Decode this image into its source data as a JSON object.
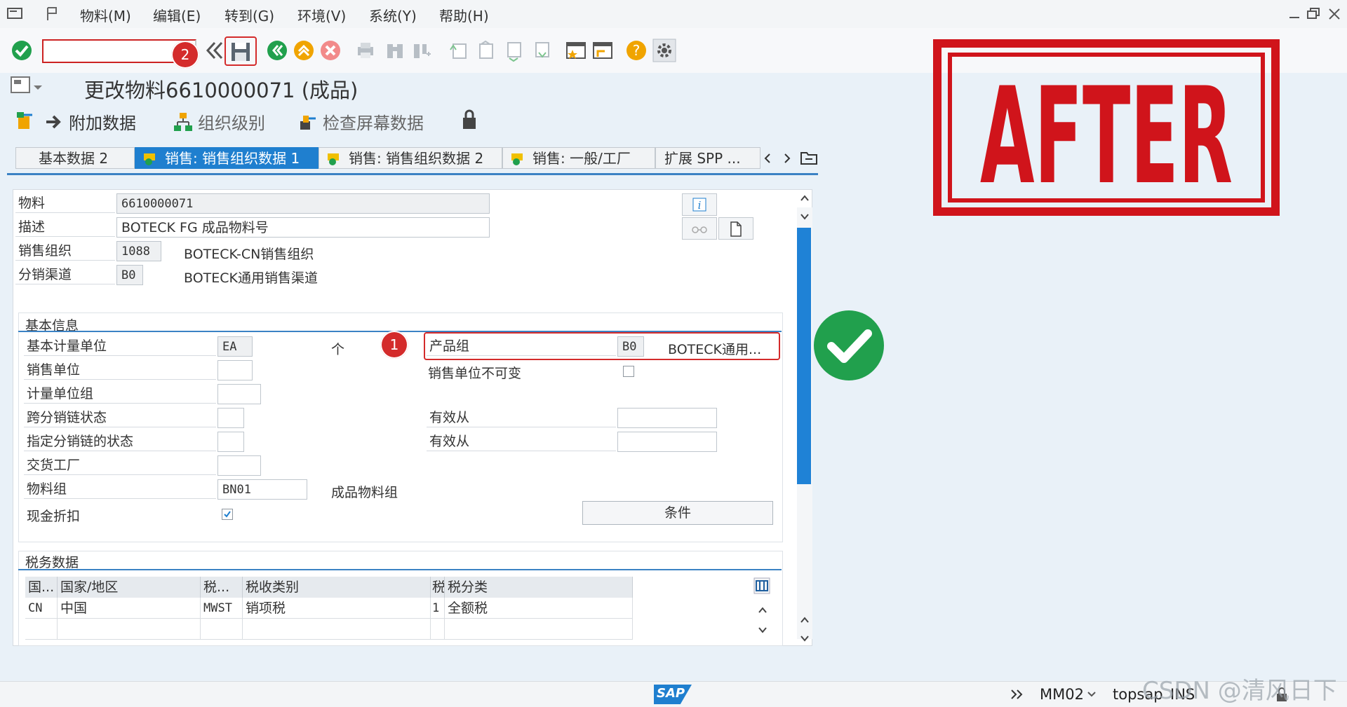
{
  "menu": [
    "物料(M)",
    "编辑(E)",
    "转到(G)",
    "环境(V)",
    "系统(Y)",
    "帮助(H)"
  ],
  "title": "更改物料6610000071 (成品)",
  "app_toolbar": {
    "additional_data": "附加数据",
    "org_levels": "组织级别",
    "check_screen": "检查屏幕数据"
  },
  "tabs": [
    "基本数据 2",
    "销售: 销售组织数据 1",
    "销售: 销售组织数据 2",
    "销售: 一般/工厂",
    "扩展 SPP ..."
  ],
  "header_fields": {
    "material_label": "物料",
    "material_value": "6610000071",
    "desc_label": "描述",
    "desc_value": "BOTECK FG 成品物料号",
    "salesorg_label": "销售组织",
    "salesorg_value": "1088",
    "salesorg_text": "BOTECK-CN销售组织",
    "channel_label": "分销渠道",
    "channel_value": "B0",
    "channel_text": "BOTECK通用销售渠道"
  },
  "basic_info": {
    "header": "基本信息",
    "base_uom_label": "基本计量单位",
    "base_uom_value": "EA",
    "base_uom_text": "个",
    "sales_unit_label": "销售单位",
    "uom_group_label": "计量单位组",
    "x_chain_status_label": "跨分销链状态",
    "dchain_status_label": "指定分销链的状态",
    "delivering_plant_label": "交货工厂",
    "material_group_label": "物料组",
    "material_group_value": "BN01",
    "material_group_text": "成品物料组",
    "cash_discount_label": "现金折扣",
    "cash_discount_checked": true,
    "product_group_label": "产品组",
    "product_group_value": "B0",
    "product_group_text": "BOTECK通用...",
    "sales_unit_not_var_label": "销售单位不可变",
    "valid_from_label_1": "有效从",
    "valid_from_label_2": "有效从",
    "conditions_button": "条件"
  },
  "tax": {
    "header": "税务数据",
    "columns": [
      "国...",
      "国家/地区",
      "税...",
      "税收类别",
      "税",
      "税分类"
    ],
    "rows": [
      [
        "CN",
        "中国",
        "MWST",
        "销项税",
        "1",
        "全额税"
      ]
    ]
  },
  "markers": [
    "1",
    "2"
  ],
  "stamp_text": "AFTER",
  "status": {
    "tcode": "MM02",
    "system": "topsap",
    "mode": "INS",
    "sap_logo": "SAP"
  },
  "watermark": "CSDN @清风日下",
  "colors": {
    "accent_blue": "#1f7fcf",
    "stamp_red": "#d0141b",
    "marker_red": "#d42b2b",
    "success_green": "#21a04d"
  }
}
